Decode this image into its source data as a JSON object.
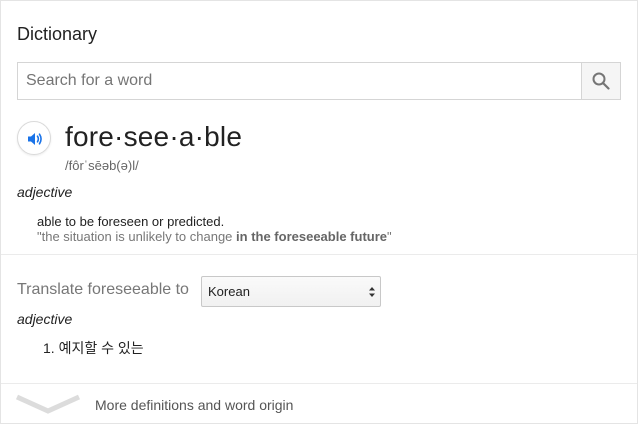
{
  "dictionary": {
    "title": "Dictionary",
    "search": {
      "placeholder": "Search for a word",
      "value": ""
    },
    "entry": {
      "headword": "fore·see·a·ble",
      "phonetic": "/fôrˈsēəb(ə)l/",
      "part_of_speech": "adjective",
      "definition": "able to be foreseen or predicted.",
      "example": {
        "open_quote": "\"",
        "prefix": "the situation is unlikely to change ",
        "highlight": "in the foreseeable future",
        "close_quote": "\""
      }
    },
    "translate": {
      "label": "Translate foreseeable to",
      "selected_language": "Korean",
      "part_of_speech": "adjective",
      "items": [
        "1. 예지할 수 있는"
      ]
    },
    "footer": {
      "more_label": "More definitions and word origin"
    },
    "colors": {
      "audio_icon": "#1a73e8",
      "search_icon": "#757575"
    }
  }
}
